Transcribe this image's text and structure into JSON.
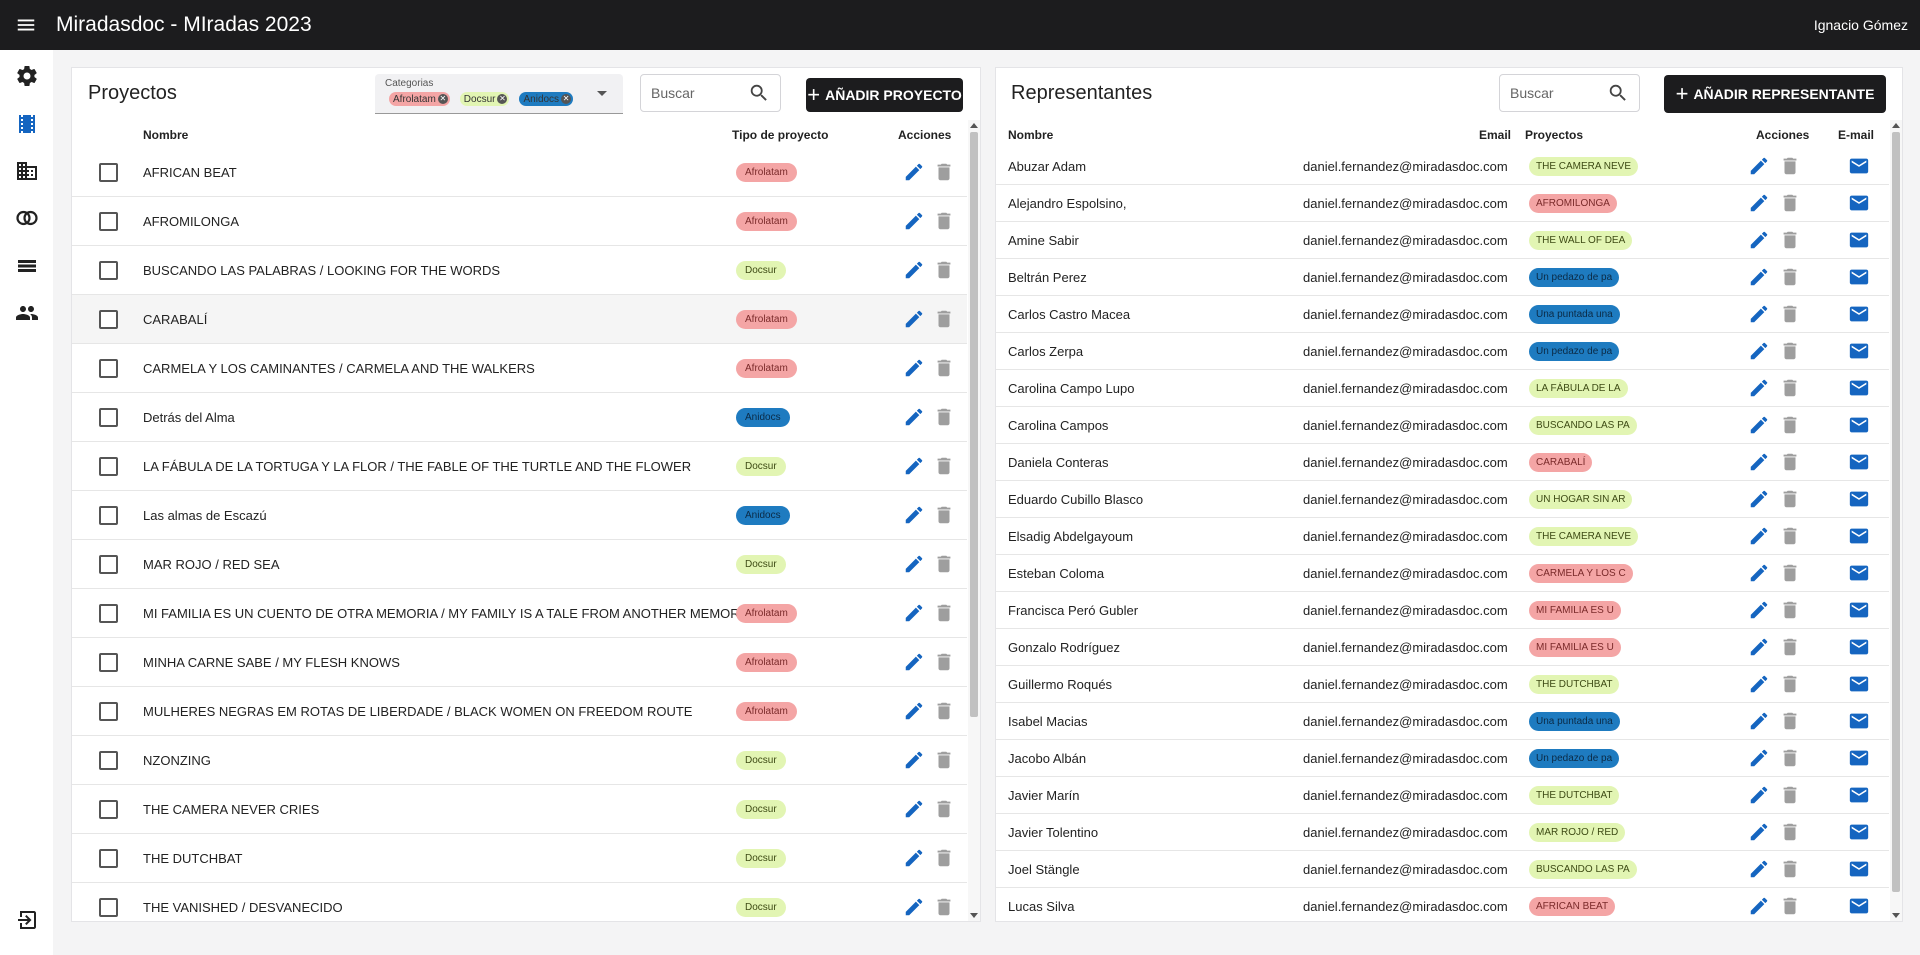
{
  "app": {
    "title": "Miradasdoc - MIradas 2023",
    "user": "Ignacio Gómez"
  },
  "nav": [
    {
      "name": "settings",
      "icon": "gear-icon"
    },
    {
      "name": "projects",
      "icon": "film-icon"
    },
    {
      "name": "companies",
      "icon": "building-icon"
    },
    {
      "name": "categories",
      "icon": "circles-icon"
    },
    {
      "name": "lists",
      "icon": "rows-icon"
    },
    {
      "name": "representatives",
      "icon": "people-icon"
    },
    {
      "name": "logout",
      "icon": "logout-icon"
    }
  ],
  "colors": {
    "accent": "#1565c0",
    "dark": "#1c1c1e",
    "afrolatam": "#f4a5a5",
    "docsur": "#e2f5b3",
    "anidocs": "#1e7bc0"
  },
  "projects": {
    "title": "Proyectos",
    "filter_label": "Categorias",
    "filter_chips": [
      {
        "label": "Afrolatam",
        "type": "afro"
      },
      {
        "label": "Docsur",
        "type": "docs"
      },
      {
        "label": "Anidocs",
        "type": "ani"
      }
    ],
    "search_placeholder": "Buscar",
    "add_label": "AÑADIR PROYECTO",
    "columns": {
      "name": "Nombre",
      "type": "Tipo de proyecto",
      "actions": "Acciones"
    },
    "rows": [
      {
        "name": "AFRICAN BEAT",
        "tag": "Afrolatam",
        "tag_type": "afro"
      },
      {
        "name": "AFROMILONGA",
        "tag": "Afrolatam",
        "tag_type": "afro"
      },
      {
        "name": "BUSCANDO LAS PALABRAS / LOOKING FOR THE WORDS",
        "tag": "Docsur",
        "tag_type": "docs"
      },
      {
        "name": "CARABALÍ",
        "tag": "Afrolatam",
        "tag_type": "afro",
        "highlight": true
      },
      {
        "name": "CARMELA Y LOS CAMINANTES / CARMELA AND THE WALKERS",
        "tag": "Afrolatam",
        "tag_type": "afro"
      },
      {
        "name": "Detrás del Alma",
        "tag": "Anidocs",
        "tag_type": "ani"
      },
      {
        "name": "LA FÁBULA DE LA TORTUGA Y LA FLOR / THE FABLE OF THE TURTLE AND THE FLOWER",
        "tag": "Docsur",
        "tag_type": "docs"
      },
      {
        "name": "Las almas de Escazú",
        "tag": "Anidocs",
        "tag_type": "ani"
      },
      {
        "name": "MAR ROJO / RED SEA",
        "tag": "Docsur",
        "tag_type": "docs"
      },
      {
        "name": "MI FAMILIA ES UN CUENTO DE OTRA MEMORIA / MY FAMILY IS A TALE FROM ANOTHER MEMORY",
        "tag": "Afrolatam",
        "tag_type": "afro"
      },
      {
        "name": "MINHA CARNE SABE / MY FLESH KNOWS",
        "tag": "Afrolatam",
        "tag_type": "afro"
      },
      {
        "name": "MULHERES NEGRAS EM ROTAS DE LIBERDADE / BLACK WOMEN ON FREEDOM ROUTE",
        "tag": "Afrolatam",
        "tag_type": "afro"
      },
      {
        "name": "NZONZING",
        "tag": "Docsur",
        "tag_type": "docs"
      },
      {
        "name": "THE CAMERA NEVER CRIES",
        "tag": "Docsur",
        "tag_type": "docs"
      },
      {
        "name": "THE DUTCHBAT",
        "tag": "Docsur",
        "tag_type": "docs"
      },
      {
        "name": "THE VANISHED / DESVANECIDO",
        "tag": "Docsur",
        "tag_type": "docs"
      }
    ]
  },
  "reps": {
    "title": "Representantes",
    "search_placeholder": "Buscar",
    "add_label": "AÑADIR REPRESENTANTE",
    "columns": {
      "name": "Nombre",
      "email": "Email",
      "projects": "Proyectos",
      "actions": "Acciones",
      "mail": "E-mail"
    },
    "rows": [
      {
        "name": "Abuzar Adam",
        "email": "daniel.fernandez@miradasdoc.com",
        "project": "THE CAMERA NEVE",
        "tag_type": "docs"
      },
      {
        "name": "Alejandro Espolsino,",
        "email": "daniel.fernandez@miradasdoc.com",
        "project": "AFROMILONGA",
        "tag_type": "afro"
      },
      {
        "name": "Amine Sabir",
        "email": "daniel.fernandez@miradasdoc.com",
        "project": "THE WALL OF DEA",
        "tag_type": "docs"
      },
      {
        "name": "Beltrán Perez",
        "email": "daniel.fernandez@miradasdoc.com",
        "project": "Un pedazo de pa",
        "tag_type": "ani"
      },
      {
        "name": "Carlos Castro Macea",
        "email": "daniel.fernandez@miradasdoc.com",
        "project": "Una puntada una",
        "tag_type": "ani"
      },
      {
        "name": "Carlos Zerpa",
        "email": "daniel.fernandez@miradasdoc.com",
        "project": "Un pedazo de pa",
        "tag_type": "ani"
      },
      {
        "name": "Carolina Campo Lupo",
        "email": "daniel.fernandez@miradasdoc.com",
        "project": "LA FÁBULA DE LA",
        "tag_type": "docs"
      },
      {
        "name": "Carolina Campos",
        "email": "daniel.fernandez@miradasdoc.com",
        "project": "BUSCANDO LAS PA",
        "tag_type": "docs"
      },
      {
        "name": "Daniela Conteras",
        "email": "daniel.fernandez@miradasdoc.com",
        "project": "CARABALÍ",
        "tag_type": "afro"
      },
      {
        "name": "Eduardo Cubillo Blasco",
        "email": "daniel.fernandez@miradasdoc.com",
        "project": "UN HOGAR SIN AR",
        "tag_type": "docs"
      },
      {
        "name": "Elsadig Abdelgayoum",
        "email": "daniel.fernandez@miradasdoc.com",
        "project": "THE CAMERA NEVE",
        "tag_type": "docs"
      },
      {
        "name": "Esteban Coloma",
        "email": "daniel.fernandez@miradasdoc.com",
        "project": "CARMELA Y LOS C",
        "tag_type": "afro"
      },
      {
        "name": "Francisca Peró Gubler",
        "email": "daniel.fernandez@miradasdoc.com",
        "project": "MI FAMILIA ES U",
        "tag_type": "afro"
      },
      {
        "name": "Gonzalo Rodríguez",
        "email": "daniel.fernandez@miradasdoc.com",
        "project": "MI FAMILIA ES U",
        "tag_type": "afro"
      },
      {
        "name": "Guillermo Roqués",
        "email": "daniel.fernandez@miradasdoc.com",
        "project": "THE DUTCHBAT",
        "tag_type": "docs"
      },
      {
        "name": "Isabel Macias",
        "email": "daniel.fernandez@miradasdoc.com",
        "project": "Una puntada una",
        "tag_type": "ani"
      },
      {
        "name": "Jacobo Albán",
        "email": "daniel.fernandez@miradasdoc.com",
        "project": "Un pedazo de pa",
        "tag_type": "ani"
      },
      {
        "name": "Javier Marín",
        "email": "daniel.fernandez@miradasdoc.com",
        "project": "THE DUTCHBAT",
        "tag_type": "docs"
      },
      {
        "name": "Javier Tolentino",
        "email": "daniel.fernandez@miradasdoc.com",
        "project": "MAR ROJO / RED",
        "tag_type": "docs"
      },
      {
        "name": "Joel Stängle",
        "email": "daniel.fernandez@miradasdoc.com",
        "project": "BUSCANDO LAS PA",
        "tag_type": "docs"
      },
      {
        "name": "Lucas Silva",
        "email": "daniel.fernandez@miradasdoc.com",
        "project": "AFRICAN BEAT",
        "tag_type": "afro"
      }
    ]
  }
}
